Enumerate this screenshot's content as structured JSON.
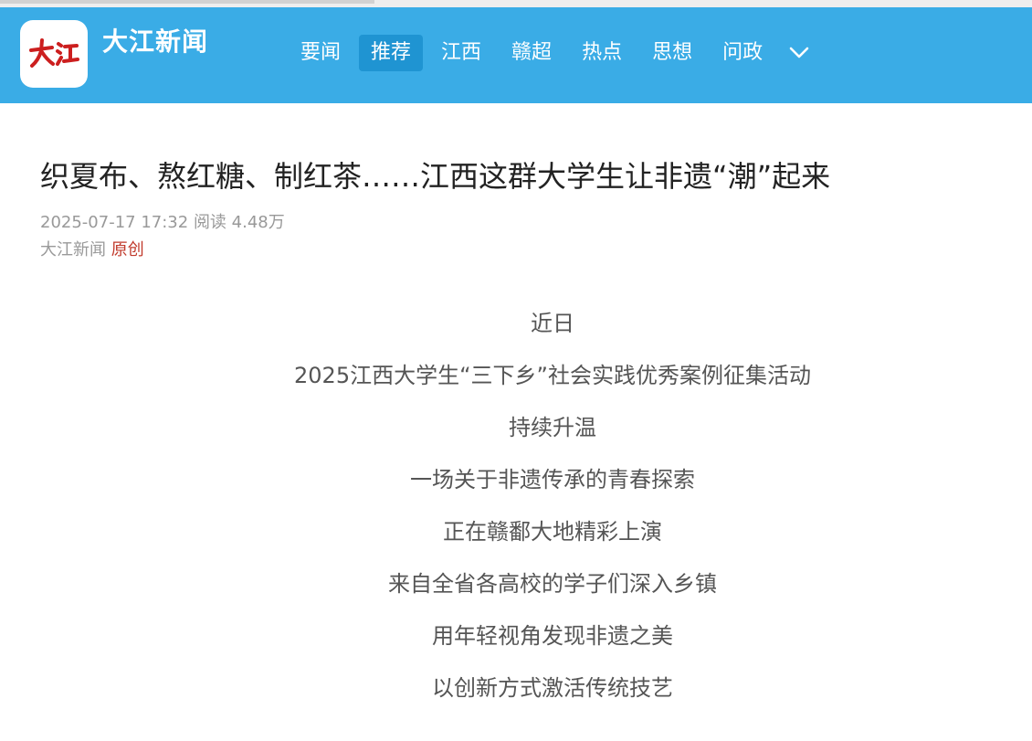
{
  "brand": {
    "name": "大江新闻",
    "logo_text": "大江",
    "logo_color": "#cc1f1f"
  },
  "nav": {
    "items": [
      {
        "label": "要闻",
        "active": false
      },
      {
        "label": "推荐",
        "active": true
      },
      {
        "label": "江西",
        "active": false
      },
      {
        "label": "赣超",
        "active": false
      },
      {
        "label": "热点",
        "active": false
      },
      {
        "label": "思想",
        "active": false
      },
      {
        "label": "问政",
        "active": false
      }
    ],
    "more_icon": "chevron-down-icon"
  },
  "article": {
    "title": "织夏布、熬红糖、制红茶……江西这群大学生让非遗“潮”起来",
    "datetime": "2025-07-17 17:32",
    "read_label": "阅读",
    "read_count": "4.48万",
    "source": "大江新闻",
    "original_tag": "原创",
    "paragraphs": [
      "近日",
      "2025江西大学生“三下乡”社会实践优秀案例征集活动",
      "持续升温",
      "一场关于非遗传承的青春探索",
      "正在赣鄱大地精彩上演",
      "来自全省各高校的学子们深入乡镇",
      "用年轻视角发现非遗之美",
      "以创新方式激活传统技艺"
    ]
  },
  "colors": {
    "header_bg": "#3aace6",
    "active_tab_bg": "#1f94d2",
    "original_tag": "#c0392b"
  }
}
